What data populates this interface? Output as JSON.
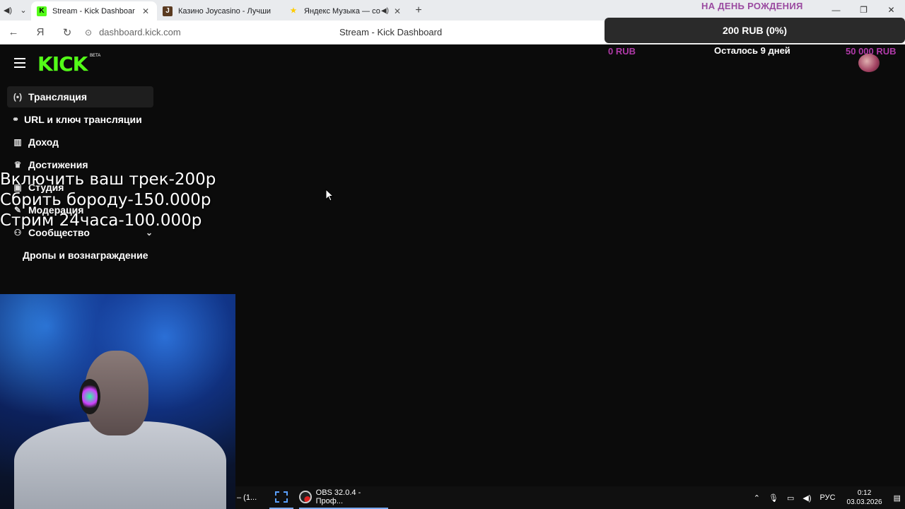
{
  "browser": {
    "tabs": [
      {
        "title": "Stream - Kick Dashboar",
        "favicon": "K",
        "favicon_color": "#53fc18",
        "active": true
      },
      {
        "title": "Казино Joycasino - Лучши",
        "favicon": "J",
        "favicon_color": "#5a3a20",
        "active": false
      },
      {
        "title": "Яндекс Музыка — со",
        "favicon": "★",
        "favicon_color": "#ffcc00",
        "active": false
      }
    ],
    "url": "dashboard.kick.com",
    "page_title": "Stream - Kick Dashboard"
  },
  "donation": {
    "header": "НА ДЕНЬ РОЖДЕНИЯ",
    "progress_text": "200 RUB (0%)",
    "min_label": "0 RUB",
    "remaining_label": "Осталось 9 дней",
    "max_label": "50 000 RUB",
    "progress_fraction": 0.004
  },
  "kick": {
    "logo": "KICK",
    "beta": "BETA",
    "sidebar": [
      {
        "label": "Трансляция",
        "icon": "broadcast-icon",
        "active": true
      },
      {
        "label": "URL и ключ трансляции",
        "icon": "link-icon",
        "active": false
      },
      {
        "label": "Доход",
        "icon": "chart-icon",
        "active": false
      },
      {
        "label": "Достижения",
        "icon": "trophy-icon",
        "active": false
      },
      {
        "label": "Студия",
        "icon": "studio-icon",
        "active": false
      },
      {
        "label": "Модерация",
        "icon": "wrench-icon",
        "active": false
      },
      {
        "label": "Сообщество",
        "icon": "community-icon",
        "active": false
      },
      {
        "label": "Дропы и вознаграждение",
        "icon": "",
        "active": false
      }
    ]
  },
  "overlay_lines": [
    "Включить ваш трек-200р",
    "Сбрить бороду-150.000р",
    "Стрим 24часа-100.000р"
  ],
  "taskbar": {
    "item1": "– (1...",
    "obs_label": "OBS 32.0.4 - Проф...",
    "lang": "РУС",
    "time": "0:12",
    "date": "03.03.2026"
  }
}
